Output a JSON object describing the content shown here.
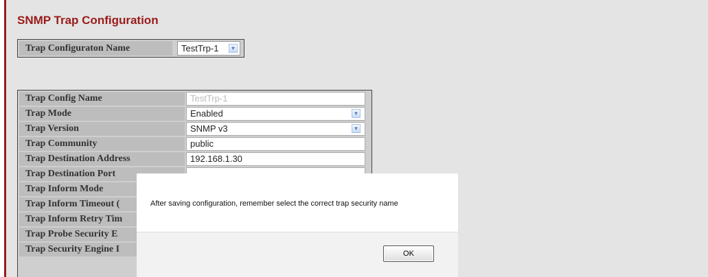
{
  "page": {
    "title": "SNMP Trap Configuration"
  },
  "trap_selector": {
    "label": "Trap Configuraton Name",
    "selected": "TestTrp-1"
  },
  "config_rows": [
    {
      "label": "Trap Config Name",
      "value": "TestTrp-1"
    },
    {
      "label": "Trap Mode",
      "value": "Enabled"
    },
    {
      "label": "Trap Version",
      "value": "SNMP v3"
    },
    {
      "label": "Trap Community",
      "value": "public"
    },
    {
      "label": "Trap Destination Address",
      "value": "192.168.1.30"
    },
    {
      "label": "Trap Destination Port",
      "value": ""
    },
    {
      "label": "Trap Inform Mode",
      "value": ""
    },
    {
      "label": "Trap Inform Timeout (",
      "value": ""
    },
    {
      "label": "Trap Inform Retry Tim",
      "value": ""
    },
    {
      "label": "Trap Probe Security E",
      "value": ""
    },
    {
      "label": "Trap Security Engine I",
      "value": ""
    }
  ],
  "dialog": {
    "message": "After saving configuration, remember select the correct trap security name",
    "ok_label": "OK"
  },
  "icons": {
    "dropdown": "chevron-down-icon"
  },
  "colors": {
    "title": "#9b1a1a",
    "label_bg": "#bdbdbd",
    "page_bg": "#e4e4e4"
  }
}
